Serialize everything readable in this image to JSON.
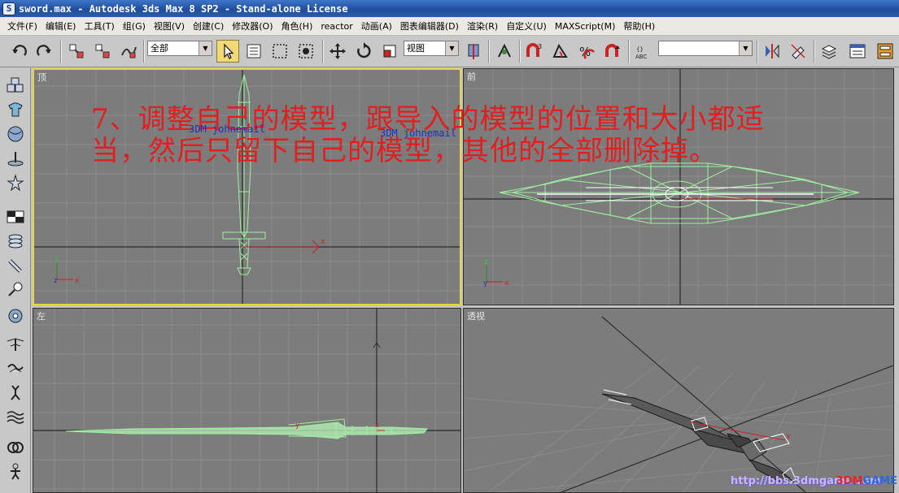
{
  "window": {
    "title": "sword.max - Autodesk 3ds Max 8 SP2  - Stand-alone License",
    "icon": "3ds-max-app-icon"
  },
  "menu": [
    "文件(F)",
    "编辑(E)",
    "工具(T)",
    "组(G)",
    "视图(V)",
    "创建(C)",
    "修改器(O)",
    "角色(H)",
    "reactor",
    "动画(A)",
    "图表编辑器(D)",
    "渲染(R)",
    "自定义(U)",
    "MAXScript(M)",
    "帮助(H)"
  ],
  "toolbar": {
    "selection_filter": "全部",
    "reference_coord": "视图",
    "named_selection": "",
    "icons": [
      "undo-icon",
      "redo-icon",
      "select-link-icon",
      "unlink-icon",
      "bind-space-warp-icon",
      "select-object-icon",
      "select-by-name-icon",
      "rectangular-selection-icon",
      "window-crossing-icon",
      "move-icon",
      "rotate-icon",
      "scale-icon",
      "use-pivot-center-icon",
      "select-manipulate-icon",
      "snaps-toggle-icon",
      "angle-snap-icon",
      "percent-snap-icon",
      "spinner-snap-icon",
      "edit-named-selection-icon",
      "mirror-icon",
      "align-icon",
      "layer-manager-icon",
      "curve-editor-icon",
      "schematic-view-icon"
    ]
  },
  "command_panel": {
    "icons": [
      "create-icon",
      "modify-icon",
      "hierarchy-icon",
      "motion-icon",
      "display-icon",
      "utilities-icon",
      "geometry-icon",
      "shapes-icon",
      "lights-icon",
      "cameras-icon",
      "helpers-icon",
      "space-warps-icon",
      "systems-icon",
      "particles-icon",
      "fluids-icon",
      "bones-icon"
    ]
  },
  "viewports": {
    "top": {
      "label": "顶"
    },
    "front": {
      "label": "前"
    },
    "left": {
      "label": "左"
    },
    "perspective": {
      "label": "透视"
    }
  },
  "overlay": {
    "instruction_line1": "7、调整自己的模型，跟导入的模型的位置和大小都适",
    "instruction_line2": "当，然后只留下自己的模型，其他的全部删除掉。",
    "object_name_1": "3DM johnemail",
    "object_name_2": "3DM johnemail"
  },
  "axes": {
    "x": "x",
    "y": "y",
    "z": "z"
  },
  "watermark": {
    "url": "http://bbs.3dmgame.com",
    "logo_red": "3DM",
    "logo_blue": "GAME"
  },
  "colors": {
    "viewport_bg": "#7c7c7c",
    "active_border": "#e8d53b",
    "wireframe": "#9ff09f",
    "annotation": "#e02020",
    "grid_major": "#2a2a2a",
    "grid_minor": "#8a8a8a"
  }
}
